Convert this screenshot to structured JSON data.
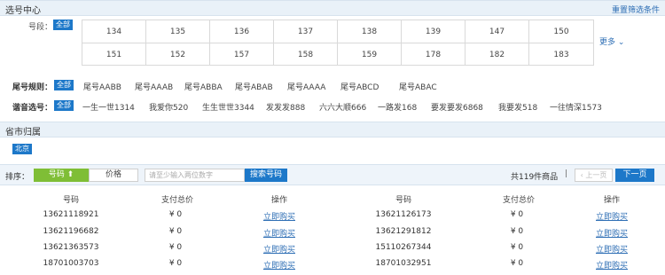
{
  "header": {
    "title": "选号中心",
    "reset": "重置筛选条件"
  },
  "segment": {
    "label": "号段：",
    "all": "全部",
    "numbers": [
      "134",
      "135",
      "136",
      "137",
      "138",
      "139",
      "147",
      "150",
      "151",
      "152",
      "157",
      "158",
      "159",
      "178",
      "182",
      "183"
    ],
    "more": "更多"
  },
  "tail_rule": {
    "label": "尾号规则：",
    "all": "全部",
    "options": [
      "尾号AABB",
      "尾号AAAB",
      "尾号ABBA",
      "尾号ABAB",
      "尾号AAAA",
      "尾号ABCD",
      "尾号ABAC"
    ]
  },
  "homophone": {
    "label": "谐音选号：",
    "all": "全部",
    "options": [
      "一生一世1314",
      "我爱你520",
      "生生世世3344",
      "发发发888",
      "六六大顺666",
      "一路发168",
      "要发要发6868",
      "我要发518",
      "一往情深1573"
    ]
  },
  "province": {
    "title": "省市归属",
    "selected": "北京"
  },
  "sort": {
    "label": "排序：",
    "by_number": "号码",
    "by_price": "价格",
    "search_placeholder": "请至少输入两位数字",
    "search_button": "搜索号码",
    "count": "共119件商品",
    "separator": "|",
    "prev": "上一页",
    "next": "下一页"
  },
  "table": {
    "headers": [
      "号码",
      "支付总价",
      "操作"
    ],
    "buy_label": "立即购买",
    "left": [
      {
        "number": "13621118921",
        "price": "¥ 0"
      },
      {
        "number": "13621196682",
        "price": "¥ 0"
      },
      {
        "number": "13621363573",
        "price": "¥ 0"
      },
      {
        "number": "18701003703",
        "price": "¥ 0"
      }
    ],
    "right": [
      {
        "number": "13621126173",
        "price": "¥ 0"
      },
      {
        "number": "13621291812",
        "price": "¥ 0"
      },
      {
        "number": "15110267344",
        "price": "¥ 0"
      },
      {
        "number": "18701032951",
        "price": "¥ 0"
      }
    ]
  }
}
